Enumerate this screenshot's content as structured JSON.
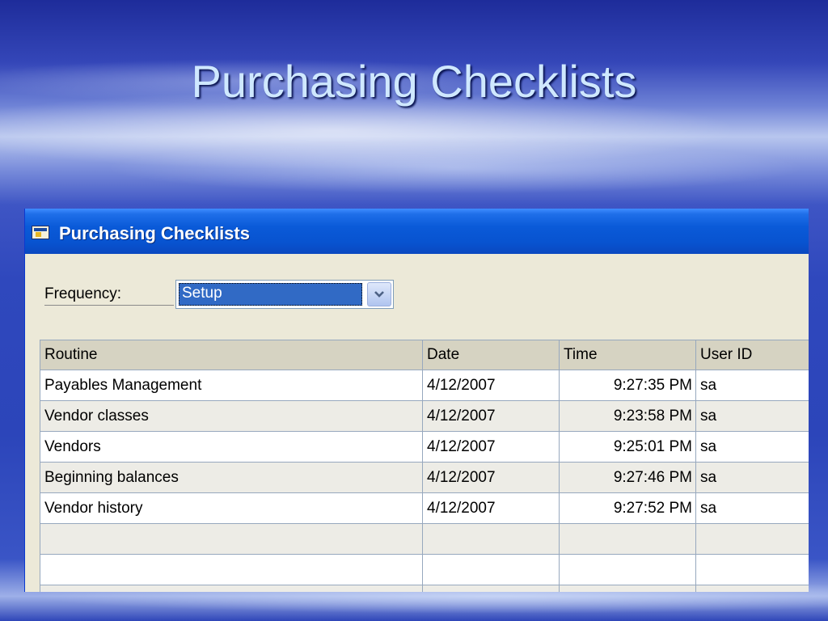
{
  "slide": {
    "title": "Purchasing Checklists"
  },
  "window": {
    "title": "Purchasing Checklists",
    "icon": "checklist-window-icon"
  },
  "frequency": {
    "label": "Frequency:",
    "value": "Setup"
  },
  "table": {
    "columns": [
      "Routine",
      "Date",
      "Time",
      "User ID"
    ],
    "rows": [
      {
        "routine": "Payables Management",
        "date": "4/12/2007",
        "time": "9:27:35 PM",
        "user_id": "sa"
      },
      {
        "routine": "Vendor classes",
        "date": "4/12/2007",
        "time": "9:23:58 PM",
        "user_id": "sa"
      },
      {
        "routine": "Vendors",
        "date": "4/12/2007",
        "time": "9:25:01 PM",
        "user_id": "sa"
      },
      {
        "routine": "Beginning balances",
        "date": "4/12/2007",
        "time": "9:27:46 PM",
        "user_id": "sa"
      },
      {
        "routine": "Vendor history",
        "date": "4/12/2007",
        "time": "9:27:52 PM",
        "user_id": "sa"
      }
    ]
  },
  "colors": {
    "titlebar": "#0a5ad8",
    "selection": "#316ac5",
    "slide_title": "#cfe8ff"
  }
}
